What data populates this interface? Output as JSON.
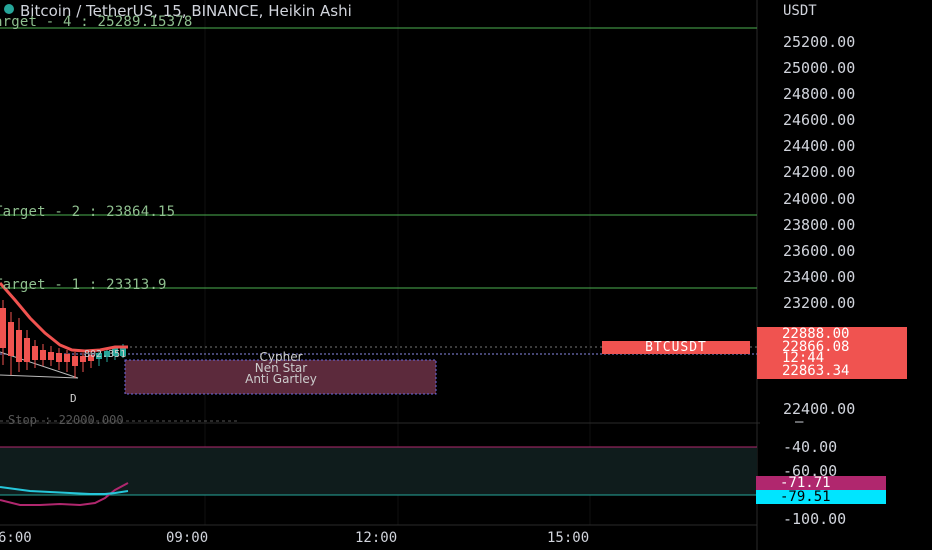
{
  "chart": {
    "title": "Bitcoin / TetherUS, 15, BINANCE, Heikin Ashi",
    "currency": "USDT",
    "targets": [
      {
        "text": "arget - 4 : 25289.15378"
      },
      {
        "text": "Target - 2 : 23864.15"
      },
      {
        "text": "Target - 1 : 23313.9"
      }
    ],
    "stop_label": "Stop : 22000.000",
    "price_axis": [
      "25200.00",
      "25000.00",
      "24800.00",
      "24600.00",
      "24400.00",
      "24200.00",
      "24000.00",
      "23800.00",
      "23600.00",
      "23400.00",
      "23200.00",
      "22400.00"
    ],
    "price_tags": {
      "high": "22888.00",
      "last": "22866.08",
      "countdown": "12:44",
      "low": "22863.34"
    },
    "symbol_tag": "BTCUSDT",
    "entry_label": "802.351",
    "point_label": "D",
    "pattern": {
      "line1": "Cypher",
      "line2": "Nen Star",
      "line3": "Anti Gartley"
    },
    "osc_axis": [
      "-40.00",
      "-60.00",
      "-100.00"
    ],
    "osc_tags": {
      "a": "-71.71",
      "b": "-79.51"
    },
    "time_axis": [
      "6:00",
      "09:00",
      "12:00",
      "15:00"
    ],
    "colors": {
      "up": "#26a69a",
      "down": "#f05350",
      "target_line": "#4caf50",
      "osc_line1": "#b0276e",
      "osc_line2": "#26c6da",
      "pattern_box": "#5c2a3c"
    }
  },
  "chart_data": {
    "type": "candlestick",
    "title": "Bitcoin / TetherUS, 15, BINANCE, Heikin Ashi",
    "target_levels": {
      "target_4": 25289.15378,
      "target_2": 23864.15,
      "target_1": 23313.9
    },
    "last_price": 22866.08,
    "oscillator": {
      "level_1": -71.71,
      "level_2": -79.51
    }
  }
}
